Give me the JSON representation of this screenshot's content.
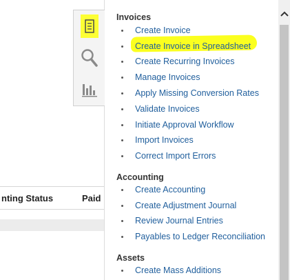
{
  "table": {
    "col_accounting_status": "nting Status",
    "col_paid": "Paid"
  },
  "icon_strip": {
    "tasks_icon": "tasks-icon",
    "search_icon": "search-icon",
    "reports_icon": "reports-icon",
    "highlight_color": "#fdff34"
  },
  "tasks_panel": {
    "sections": [
      {
        "title": "Invoices",
        "items": [
          "Create Invoice",
          "Create Invoice in Spreadsheet",
          "Create Recurring Invoices",
          "Manage Invoices",
          "Apply Missing Conversion Rates",
          "Validate Invoices",
          "Initiate Approval Workflow",
          "Import Invoices",
          "Correct Import Errors"
        ]
      },
      {
        "title": "Accounting",
        "items": [
          "Create Accounting",
          "Create Adjustment Journal",
          "Review Journal Entries",
          "Payables to Ledger Reconciliation"
        ]
      },
      {
        "title": "Assets",
        "items": [
          "Create Mass Additions"
        ]
      }
    ],
    "link_color": "#1f5e9c"
  }
}
